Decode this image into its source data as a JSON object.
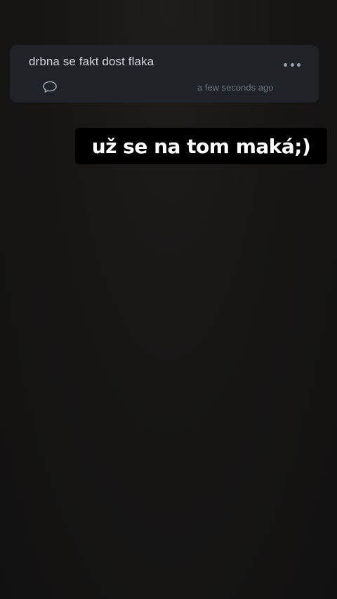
{
  "post": {
    "text": "drbna se fakt dost flaka",
    "timestamp": "a few seconds ago",
    "more_icon": "more-horizontal-icon",
    "comment_icon": "comment-bubble-icon"
  },
  "overlay": {
    "text": "už se na tom maká;)"
  },
  "colors": {
    "background": "#161514",
    "card": "#1f2328",
    "card_text": "#d4d8dd",
    "muted": "#6c747d",
    "sticker_bg": "#000000",
    "sticker_text": "#ffffff"
  }
}
